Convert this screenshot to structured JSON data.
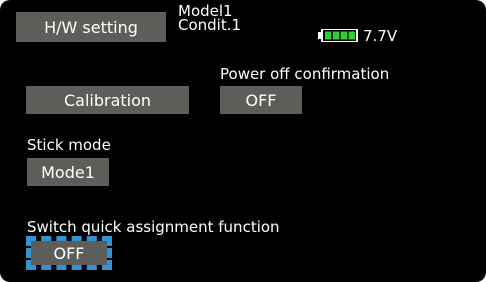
{
  "header": {
    "title_button": "H/W setting",
    "model_name": "Model1",
    "condition": "Condit.1",
    "battery_voltage": "7.7V",
    "battery_level": 1.0,
    "battery_color": "#2fd12f"
  },
  "calibration": {
    "button_label": "Calibration"
  },
  "power_off_confirmation": {
    "label": "Power off confirmation",
    "value": "OFF"
  },
  "stick_mode": {
    "label": "Stick mode",
    "value": "Mode1"
  },
  "switch_quick_assignment": {
    "label": "Switch quick assignment function",
    "value": "OFF",
    "focus_color": "#2f93d6"
  }
}
